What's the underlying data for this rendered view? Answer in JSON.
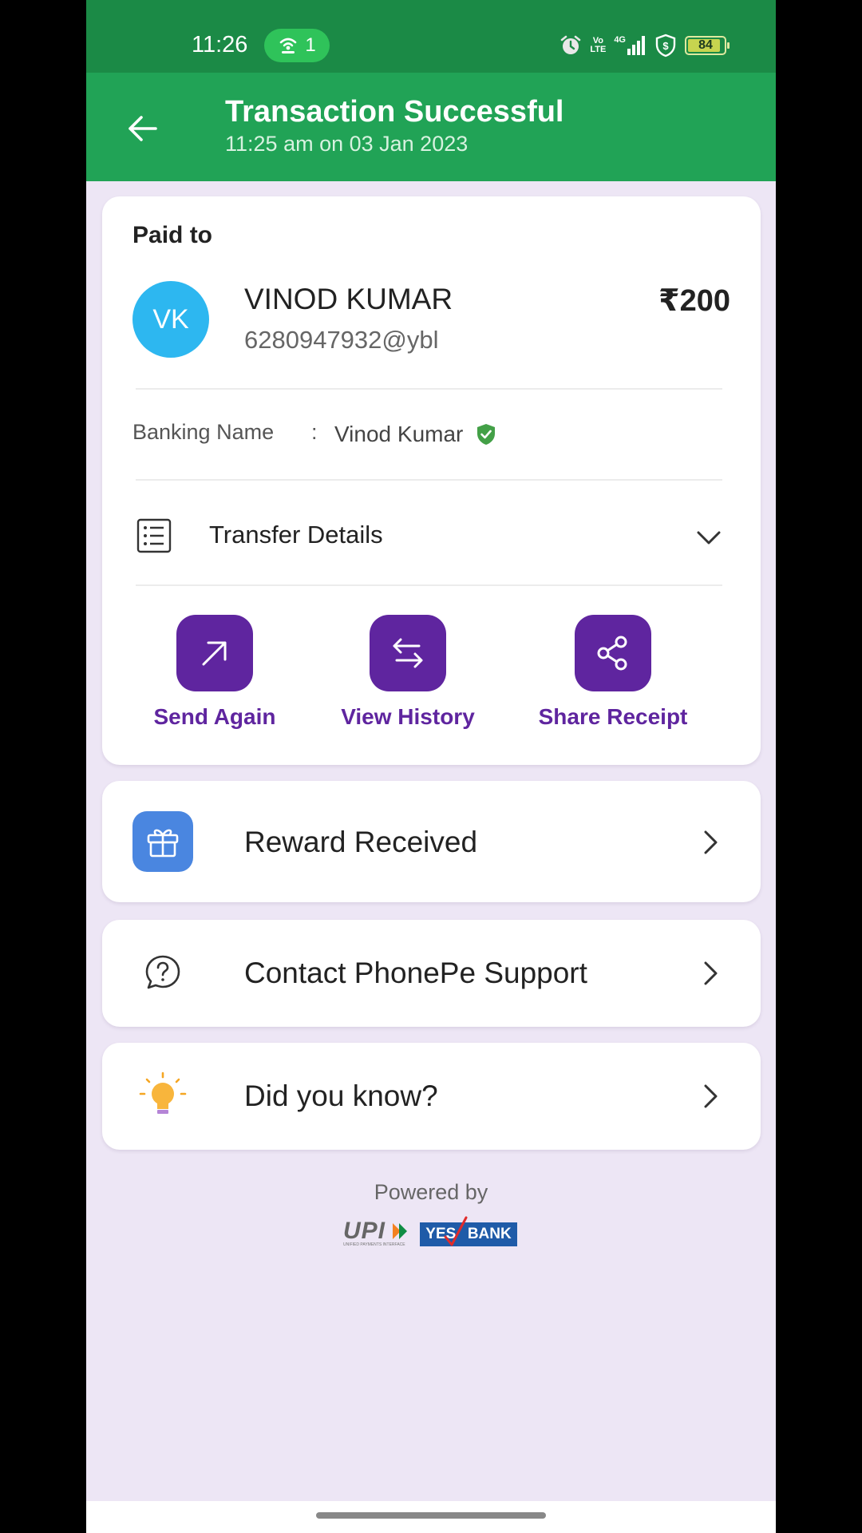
{
  "status_bar": {
    "time": "11:26",
    "hotspot_count": "1",
    "network_top": "Vo",
    "network_bottom": "LTE",
    "network_type": "4G",
    "battery": "84"
  },
  "header": {
    "title": "Transaction Successful",
    "subtitle": "11:25 am on 03 Jan 2023",
    "background": "#21a356"
  },
  "payment": {
    "paid_to_label": "Paid to",
    "avatar_initials": "VK",
    "payee_name": "VINOD KUMAR",
    "payee_vpa": "6280947932@ybl",
    "amount": "₹200",
    "banking_name_label": "Banking Name",
    "banking_name_sep": ":",
    "banking_name_value": "Vinod Kumar",
    "transfer_details_label": "Transfer Details"
  },
  "actions": [
    {
      "label": "Send Again",
      "icon": "arrow-up-right-icon"
    },
    {
      "label": "View History",
      "icon": "swap-arrows-icon"
    },
    {
      "label": "Share Receipt",
      "icon": "share-icon"
    }
  ],
  "rows": [
    {
      "label": "Reward Received",
      "icon": "gift-icon"
    },
    {
      "label": "Contact PhonePe Support",
      "icon": "help-chat-icon"
    },
    {
      "label": "Did you know?",
      "icon": "lightbulb-icon"
    }
  ],
  "footer": {
    "powered_by": "Powered by",
    "upi_logo_text": "UPI",
    "upi_logo_subtext": "UNIFIED PAYMENTS INTERFACE",
    "bank_logo_word1": "YES",
    "bank_logo_word2": "BANK"
  },
  "colors": {
    "accent_purple": "#5f259f",
    "background": "#ede6f5",
    "status_green": "#1b8a46"
  }
}
